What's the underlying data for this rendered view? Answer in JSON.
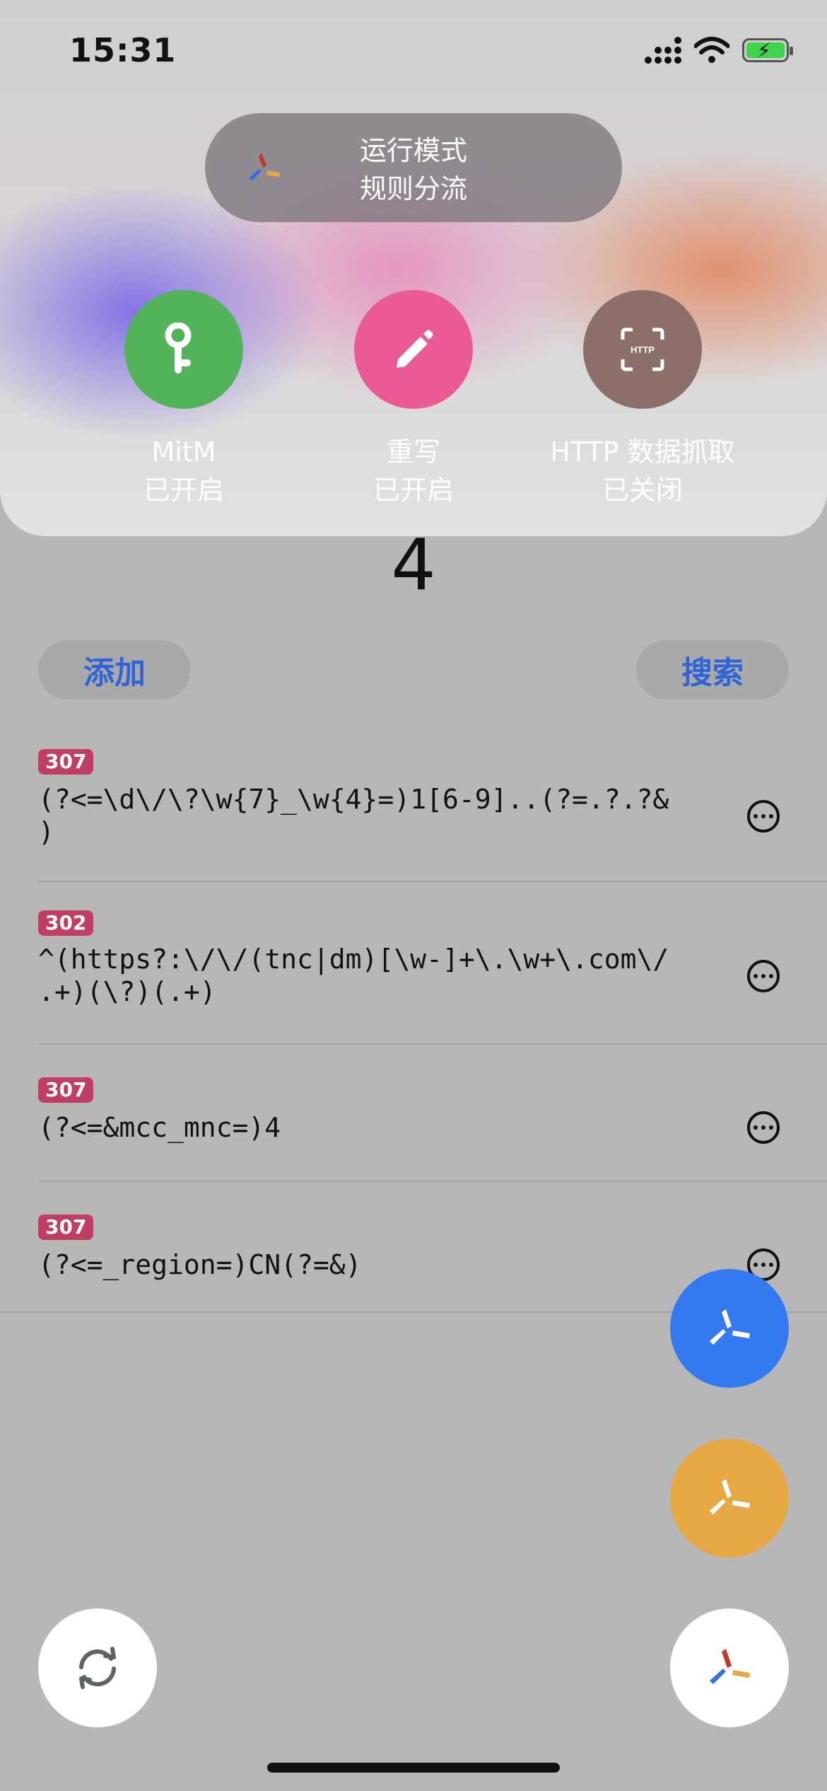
{
  "status_bar": {
    "time": "15:31"
  },
  "mode_panel": {
    "title": "运行模式",
    "value": "规则分流"
  },
  "toggles": [
    {
      "name": "MitM",
      "state": "已开启",
      "color": "#52b35a",
      "icon": "key-icon"
    },
    {
      "name": "重写",
      "state": "已开启",
      "color": "#ea5b96",
      "icon": "pencil-icon"
    },
    {
      "name": "HTTP 数据抓取",
      "state": "已关闭",
      "color": "#8d6f6a",
      "icon": "http-capture-icon"
    }
  ],
  "count": "4",
  "actions": {
    "add_label": "添加",
    "search_label": "搜索"
  },
  "rules": [
    {
      "code": "307",
      "pattern": "(?<=\\d\\/\\?\\w{7}_\\w{4}=)1[6-9]..(?=.?.?&\n)"
    },
    {
      "code": "302",
      "pattern": "^(https?:\\/\\/(tnc|dm)[\\w-]+\\.\\w+\\.com\\/\n.+)(\\?)(.+)"
    },
    {
      "code": "307",
      "pattern": "(?<=&mcc_mnc=)4"
    },
    {
      "code": "307",
      "pattern": "(?<=_region=)CN(?=&)"
    }
  ],
  "colors": {
    "accent": "#2f64d8",
    "badge": "#c03d64",
    "fab_blue": "#3479ef",
    "fab_orange": "#e6a842"
  }
}
